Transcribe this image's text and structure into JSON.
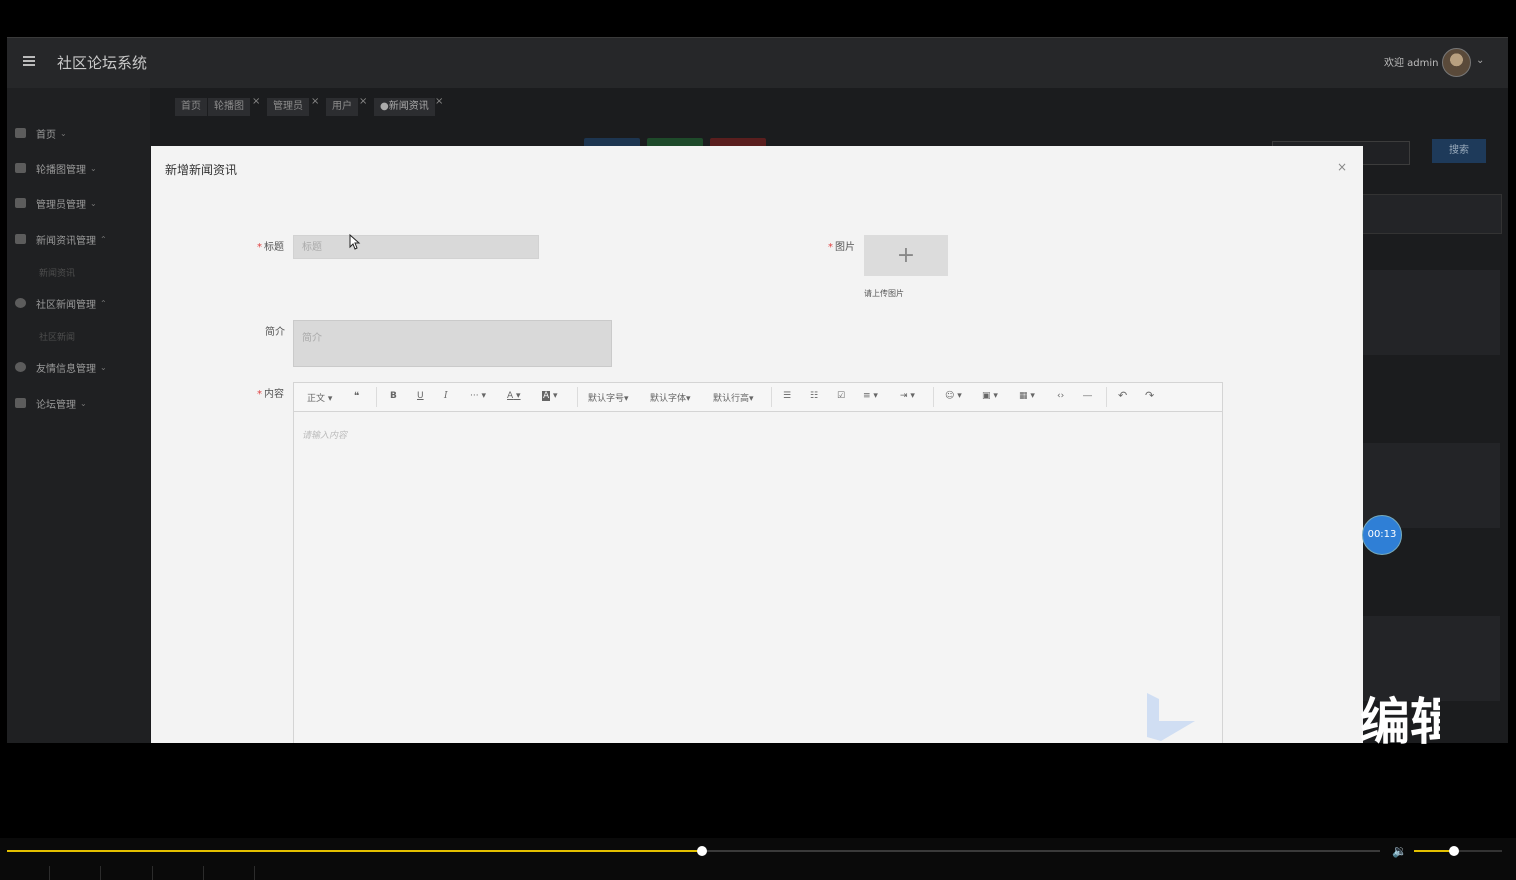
{
  "header": {
    "app_title": "社区论坛系统",
    "welcome": "欢迎 admin"
  },
  "sidebar": {
    "items": [
      {
        "label": "首页",
        "icon": "home-icon"
      },
      {
        "label": "轮播图管理",
        "icon": "image-icon"
      },
      {
        "label": "管理员管理",
        "icon": "admin-icon"
      },
      {
        "label": "新闻资讯管理",
        "icon": "news-icon",
        "expanded": true,
        "sub": "新闻资讯"
      },
      {
        "label": "社区新闻管理",
        "icon": "community-icon",
        "expanded": true,
        "sub": "社区新闻"
      },
      {
        "label": "友情信息管理",
        "icon": "link-icon"
      },
      {
        "label": "论坛管理",
        "icon": "forum-icon"
      }
    ]
  },
  "tabs": [
    {
      "label": "首页",
      "closable": false
    },
    {
      "label": "轮播图",
      "closable": true
    },
    {
      "label": "管理员",
      "closable": true
    },
    {
      "label": "用户",
      "closable": true
    },
    {
      "label": "●新闻资讯",
      "closable": true,
      "active": true
    }
  ],
  "main": {
    "search_button": "搜索"
  },
  "modal": {
    "title": "新增新闻资讯",
    "close": "×",
    "fields": {
      "title_label": "标题",
      "title_placeholder": "标题",
      "image_label": "图片",
      "upload_plus": "+",
      "upload_hint": "请上传图片",
      "summary_label": "简介",
      "summary_placeholder": "简介",
      "content_label": "内容",
      "required_mark": "*"
    },
    "editor": {
      "placeholder": "请输入内容",
      "toolbar": {
        "paragraph": "正文",
        "quote": "❝",
        "bold": "B",
        "underline": "U",
        "italic": "I",
        "more": "···",
        "font_color": "A",
        "bg_color": "A",
        "font_size": "默认字号",
        "font_family": "默认字体",
        "line_height": "默认行高",
        "bullet_list": "☰",
        "numbered_list": "☷",
        "todo": "☑",
        "align": "≡",
        "indent": "⇥",
        "emoji": "☺",
        "image": "▣",
        "table": "▦",
        "code": "‹›",
        "divider": "―",
        "undo": "↶",
        "redo": "↷"
      }
    }
  },
  "overlay": {
    "timer": "00:13",
    "subtitle_fragment": "编辑"
  },
  "player": {
    "progress": 0.506,
    "volume": 0.45,
    "accent_color": "#e3c000"
  }
}
